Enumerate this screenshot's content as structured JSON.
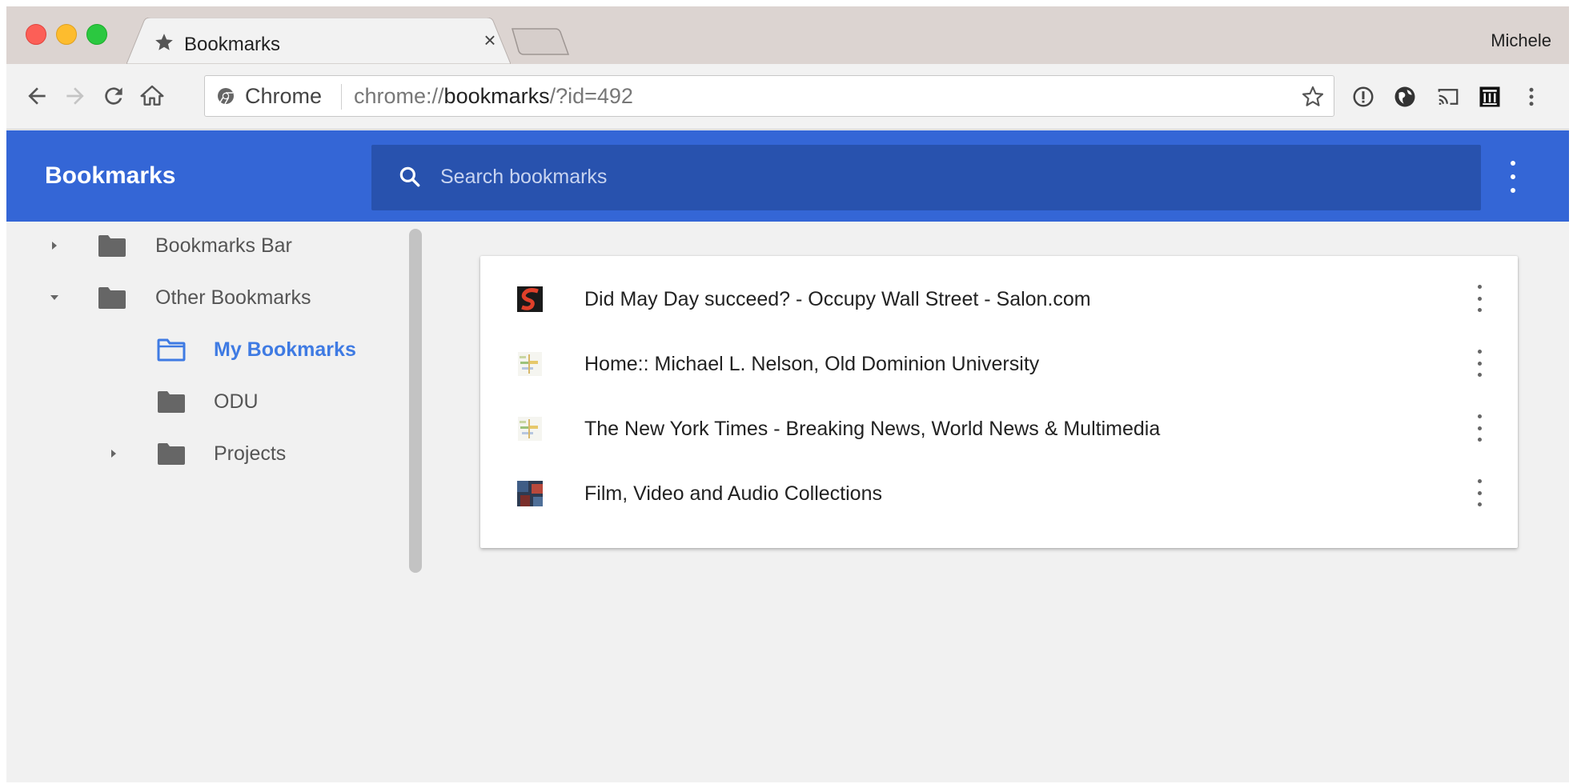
{
  "browser": {
    "tab": {
      "title": "Bookmarks",
      "icon": "star-icon",
      "close_label": "×"
    },
    "profile_name": "Michele",
    "omnibox": {
      "chip_label": "Chrome",
      "url_prefix": "chrome://",
      "url_host": "bookmarks",
      "url_suffix": "/?id=492"
    },
    "extensions": [
      "info-extension-icon",
      "globe-extension-icon",
      "cast-icon",
      "archive-extension-icon",
      "more-vert-icon"
    ]
  },
  "app": {
    "title": "Bookmarks",
    "search_placeholder": "Search bookmarks",
    "accent_color": "#3466d6",
    "search_bg_color": "#2852ae"
  },
  "sidebar": {
    "items": [
      {
        "label": "Bookmarks Bar",
        "arrow": "right",
        "selected": false
      },
      {
        "label": "Other Bookmarks",
        "arrow": "down",
        "selected": false
      },
      {
        "label": "My Bookmarks",
        "arrow": "none",
        "selected": true
      },
      {
        "label": "ODU",
        "arrow": "none",
        "selected": false
      },
      {
        "label": "Projects",
        "arrow": "right",
        "selected": false
      }
    ],
    "selected_color": "#3f7be3"
  },
  "bookmarks": [
    {
      "title": "Did May Day succeed? - Occupy Wall Street - Salon.com",
      "favicon": "salon-favicon-icon"
    },
    {
      "title": "Home:: Michael L. Nelson, Old Dominion University",
      "favicon": "generic-page-favicon-icon"
    },
    {
      "title": "The New York Times - Breaking News, World News & Multimedia",
      "favicon": "generic-page-favicon-icon"
    },
    {
      "title": "Film, Video and Audio Collections",
      "favicon": "archive-collection-favicon-icon"
    }
  ]
}
